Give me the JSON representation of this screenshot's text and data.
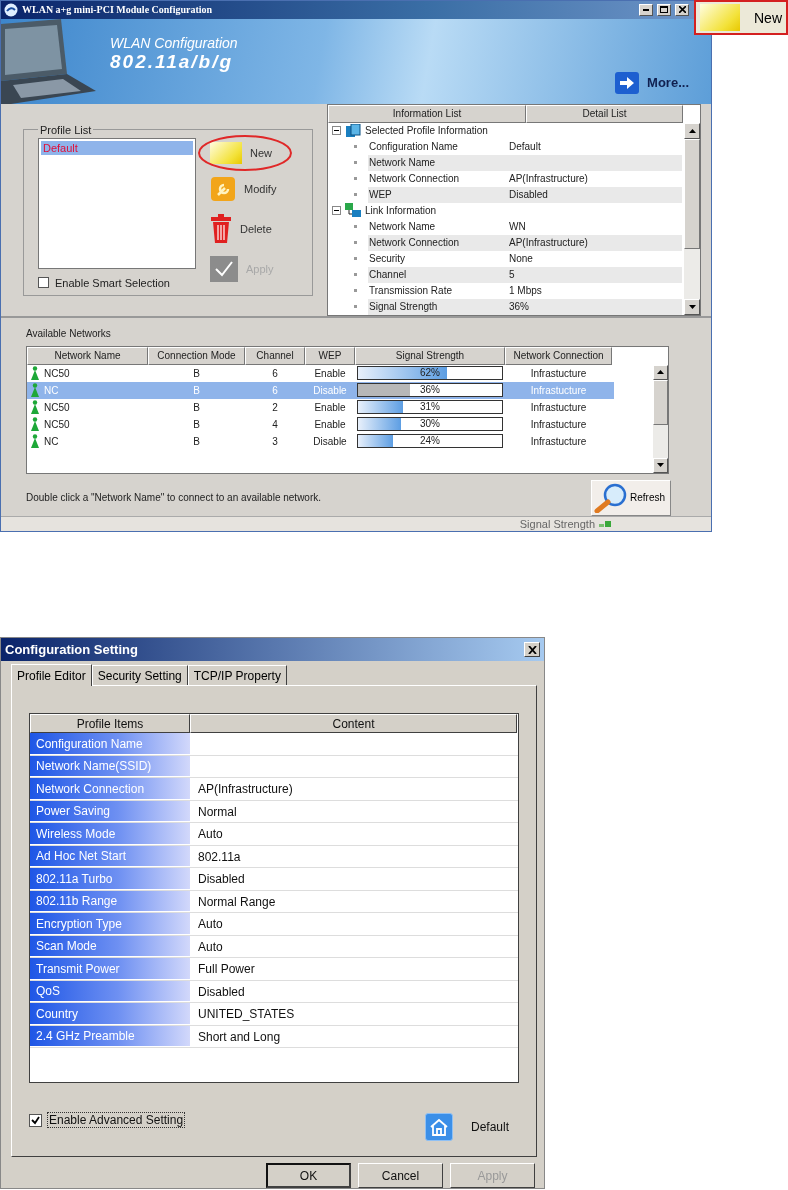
{
  "main_window": {
    "title": "WLAN a+g mini-PCI Module Configuration",
    "banner": {
      "title": "WLAN Configuration",
      "subtitle": "802.11a/b/g",
      "more": "More..."
    },
    "profile_list": {
      "label": "Profile List",
      "items": [
        {
          "text": "Default",
          "selected": true
        }
      ],
      "buttons": [
        {
          "kind": "new",
          "label": "New",
          "disabled": false,
          "circled": true
        },
        {
          "kind": "modify",
          "label": "Modify",
          "disabled": false,
          "circled": false
        },
        {
          "kind": "delete",
          "label": "Delete",
          "disabled": false,
          "circled": false
        },
        {
          "kind": "apply",
          "label": "Apply",
          "disabled": true,
          "circled": false
        }
      ],
      "smart_selection": {
        "label": "Enable Smart Selection",
        "checked": false
      }
    },
    "info": {
      "columns": [
        "Information List",
        "Detail List"
      ],
      "groups": [
        {
          "kind": "profile",
          "title": "Selected Profile Information",
          "children": [
            {
              "name": "Configuration Name",
              "value": "Default"
            },
            {
              "name": "Network Name"
            },
            {
              "name": "Network Connection",
              "value": "AP(Infrastructure)"
            },
            {
              "name": "WEP",
              "value": "Disabled"
            }
          ]
        },
        {
          "kind": "link",
          "title": "Link Information",
          "children": [
            {
              "name": "Network Name",
              "value": "WN"
            },
            {
              "name": "Network Connection",
              "value": "AP(Infrastructure)"
            },
            {
              "name": "Security",
              "value": "None"
            },
            {
              "name": "Channel",
              "value": "5"
            },
            {
              "name": "Transmission Rate",
              "value": "1 Mbps"
            },
            {
              "name": "Signal Strength",
              "value": "36%"
            }
          ]
        }
      ]
    },
    "networks": {
      "label": "Available Networks",
      "columns": [
        "Network Name",
        "Connection Mode",
        "Channel",
        "WEP",
        "Signal Strength",
        "Network Connection"
      ],
      "rows": [
        {
          "name": "NC50",
          "mode": "B",
          "channel": "6",
          "wep": "Enable",
          "level": 0.62,
          "strength": "62%",
          "connection": "Infrastucture",
          "selected": false
        },
        {
          "name": "NC",
          "mode": "B",
          "channel": "6",
          "wep": "Disable",
          "level": 0.36,
          "strength": "36%",
          "connection": "Infrastucture",
          "selected": true
        },
        {
          "name": "NC50",
          "mode": "B",
          "channel": "2",
          "wep": "Enable",
          "level": 0.31,
          "strength": "31%",
          "connection": "Infrastucture",
          "selected": false
        },
        {
          "name": "NC50",
          "mode": "B",
          "channel": "4",
          "wep": "Enable",
          "level": 0.3,
          "strength": "30%",
          "connection": "Infrastucture",
          "selected": false
        },
        {
          "name": "NC",
          "mode": "B",
          "channel": "3",
          "wep": "Disable",
          "level": 0.24,
          "strength": "24%",
          "connection": "Infrastucture",
          "selected": false
        }
      ],
      "hint": "Double click a \"Network Name\" to connect to an available network.",
      "refresh": "Refresh"
    },
    "status_bar": {
      "label": "Signal Strength"
    }
  },
  "callout": {
    "label": "New"
  },
  "dialog": {
    "title": "Configuration Setting",
    "tabs": [
      {
        "label": "Profile Editor",
        "selected": true
      },
      {
        "label": "Security Setting",
        "selected": false
      },
      {
        "label": "TCP/IP Property",
        "selected": false
      }
    ],
    "columns": [
      "Profile Items",
      "Content"
    ],
    "rows": [
      {
        "item": "Configuration Name"
      },
      {
        "item": "Network Name(SSID)"
      },
      {
        "item": "Network Connection",
        "content": "AP(Infrastructure)"
      },
      {
        "item": "Power Saving",
        "content": "Normal"
      },
      {
        "item": "Wireless Mode",
        "content": "Auto"
      },
      {
        "item": "Ad Hoc Net Start",
        "content": "802.11a"
      },
      {
        "item": "802.11a Turbo",
        "content": "Disabled"
      },
      {
        "item": "802.11b Range",
        "content": "Normal Range"
      },
      {
        "item": "Encryption Type",
        "content": "Auto"
      },
      {
        "item": "Scan Mode",
        "content": "Auto"
      },
      {
        "item": "Transmit Power",
        "content": "Full Power"
      },
      {
        "item": "QoS",
        "content": "Disabled"
      },
      {
        "item": "Country",
        "content": "UNITED_STATES"
      },
      {
        "item": "2.4 GHz Preamble",
        "content": "Short and Long"
      }
    ],
    "advanced": {
      "label": "Enable Advanced Setting",
      "checked": true
    },
    "default_label": "Default",
    "buttons": [
      {
        "label": "OK",
        "disabled": false
      },
      {
        "label": "Cancel",
        "disabled": false
      },
      {
        "label": "Apply",
        "disabled": true
      }
    ]
  }
}
